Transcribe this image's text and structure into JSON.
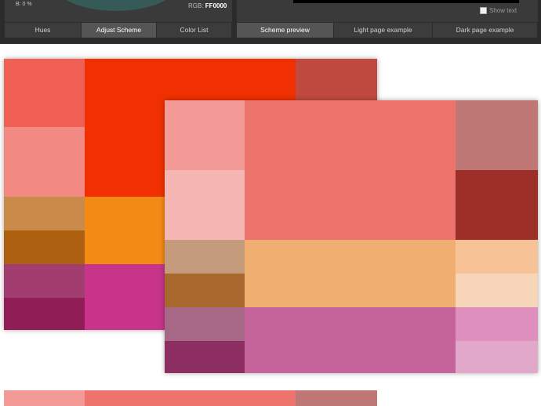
{
  "toolbar": {
    "b_readout": "B:   0 %",
    "rgb_label": "RGB:",
    "rgb_value": "FF0000",
    "show_text_label": "Show text",
    "left_tabs": [
      "Hues",
      "Adjust Scheme",
      "Color List"
    ],
    "right_tabs": [
      "Scheme preview",
      "Light page example",
      "Dark page example"
    ],
    "wheel_color": "#355a57"
  },
  "schemes": {
    "scheme_a": {
      "colors": {
        "left": [
          "#f06055",
          "#f28a83",
          "#c98a4a",
          "#ad600f",
          "#a23d6f",
          "#901d56"
        ],
        "center_top": "#f03000",
        "center_mid": "#f38a16",
        "center_bottom": "#c7348a",
        "right_top": "#c04a40"
      }
    },
    "scheme_b": {
      "colors": {
        "left": [
          "#f39a96",
          "#f4b5b3",
          "#c49b7b",
          "#a9682d",
          "#a66885",
          "#8c2e62"
        ],
        "center_top": "#ec746c",
        "center_mid": "#f0ae71",
        "center_bottom": "#c4649b",
        "right": [
          "#bf7875",
          "#9c3029",
          "#f7c396",
          "#f7d5b8",
          "#df8fbd",
          "#e1a8c9"
        ]
      }
    },
    "scheme_c": {
      "colors": {
        "left": "#f39a96",
        "center": "#ec746c",
        "right": "#bf7875"
      }
    }
  }
}
